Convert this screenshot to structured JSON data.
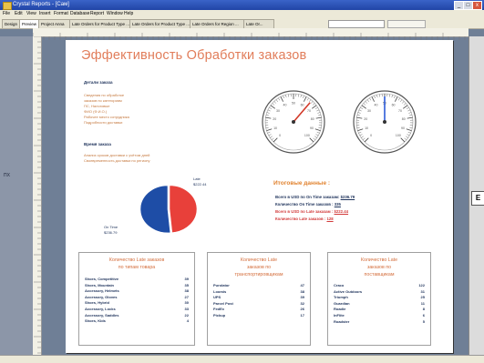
{
  "window": {
    "title": "Crystal Reports - [Сам]",
    "min": "_",
    "max": "□",
    "close": "x"
  },
  "menu": [
    "File",
    "Edit",
    "View",
    "Insert",
    "Format",
    "Database",
    "Report",
    "Window",
    "Help"
  ],
  "tabs": [
    "Design",
    "Preview",
    "Project Anna",
    "Late Orders for Product Type ...",
    "Late Orders for Product Type ...",
    "Late Orders for Region ...",
    "Late Or..."
  ],
  "active_tab_index": 1,
  "sidebar": {
    "label": "ПХ"
  },
  "right_panel": {
    "letter": "E"
  },
  "report": {
    "title": "Эффективность Обработки заказов",
    "section1": {
      "heading": "Детали заказа",
      "lines": [
        "Сведения по обработке",
        "заказов по категориям",
        "ПС, Налоговые",
        "ФИО (Ф.И.О.)",
        "Рабочее место сотрудника",
        "Подробности доставки"
      ]
    },
    "section2": {
      "heading": "Время заказа",
      "lines": [
        "Анализ сроков доставки с учётом дней",
        "Своевременность доставки по региону"
      ]
    },
    "pie": {
      "chart_data": {
        "type": "pie",
        "categories": [
          "Late",
          "On Time"
        ],
        "values": [
          48.5,
          51.5
        ],
        "labels": [
          "Late\n$222.44",
          "On Time\n$236.79"
        ],
        "colors": [
          "#e8403a",
          "#1e4da6"
        ]
      }
    },
    "pie_labels": {
      "late": "Late",
      "late_value": "$222.44",
      "ontime": "On Time",
      "ontime_value": "$236.79"
    },
    "gauge_left": {
      "chart_data": {
        "type": "gauge",
        "min": 0,
        "max": 100,
        "value": 65,
        "needle_color": "#d23a2a"
      }
    },
    "gauge_right": {
      "chart_data": {
        "type": "gauge",
        "min": 0,
        "max": 100,
        "value": 50,
        "needle_color": "#2d5bd8"
      }
    },
    "gauge_ticks": [
      "0",
      "10",
      "20",
      "30",
      "40",
      "50",
      "60",
      "70",
      "80",
      "90",
      "100"
    ],
    "totals": {
      "heading": "Итоговые данные :",
      "rows": [
        {
          "text": "Всего в USD по On Time заказам:",
          "value": "$236.79",
          "color": "#22365e"
        },
        {
          "text": "Количество On Time заказов :",
          "value": "335",
          "color": "#22365e"
        },
        {
          "text": "Всего в USD по Late заказам :",
          "value": "$222.44",
          "color": "#d23a3a"
        },
        {
          "text": "Количество Late заказов :",
          "value": "128",
          "color": "#d23a3a"
        }
      ]
    },
    "box1": {
      "heading": [
        "Количество Late заказов",
        "по типам товара"
      ],
      "rows": [
        [
          "Shoes, Competitive",
          "39"
        ],
        [
          "Shoes, Mountain",
          "35"
        ],
        [
          "Accessory, Helmets",
          "38"
        ],
        [
          "Accessory, Gloves",
          "27"
        ],
        [
          "Shoes, Hybrid",
          "30"
        ],
        [
          "Accessory, Locks",
          "33"
        ],
        [
          "Accessory, Saddles",
          "22"
        ],
        [
          "Shoes, Kids",
          "4"
        ]
      ]
    },
    "box2": {
      "heading": [
        "Количество Late",
        "заказов по",
        "транспортировщикам"
      ],
      "rows": [
        [
          "Purolator",
          "47"
        ],
        [
          "Loomis",
          "38"
        ],
        [
          "UPS",
          "39"
        ],
        [
          "Parcel Post",
          "32"
        ],
        [
          "FedEx",
          "26"
        ],
        [
          "Pickup",
          "17"
        ]
      ]
    },
    "box3": {
      "heading": [
        "Количество Late",
        "заказов по",
        "поставщикам"
      ],
      "rows": [
        [
          "Craco",
          "122"
        ],
        [
          "Active Outdoors",
          "31"
        ],
        [
          "Triumph",
          "25"
        ],
        [
          "Guardian",
          "11"
        ],
        [
          "Roadie",
          "8"
        ],
        [
          "InFlite",
          "6"
        ],
        [
          "Roadster",
          "5"
        ]
      ]
    }
  }
}
